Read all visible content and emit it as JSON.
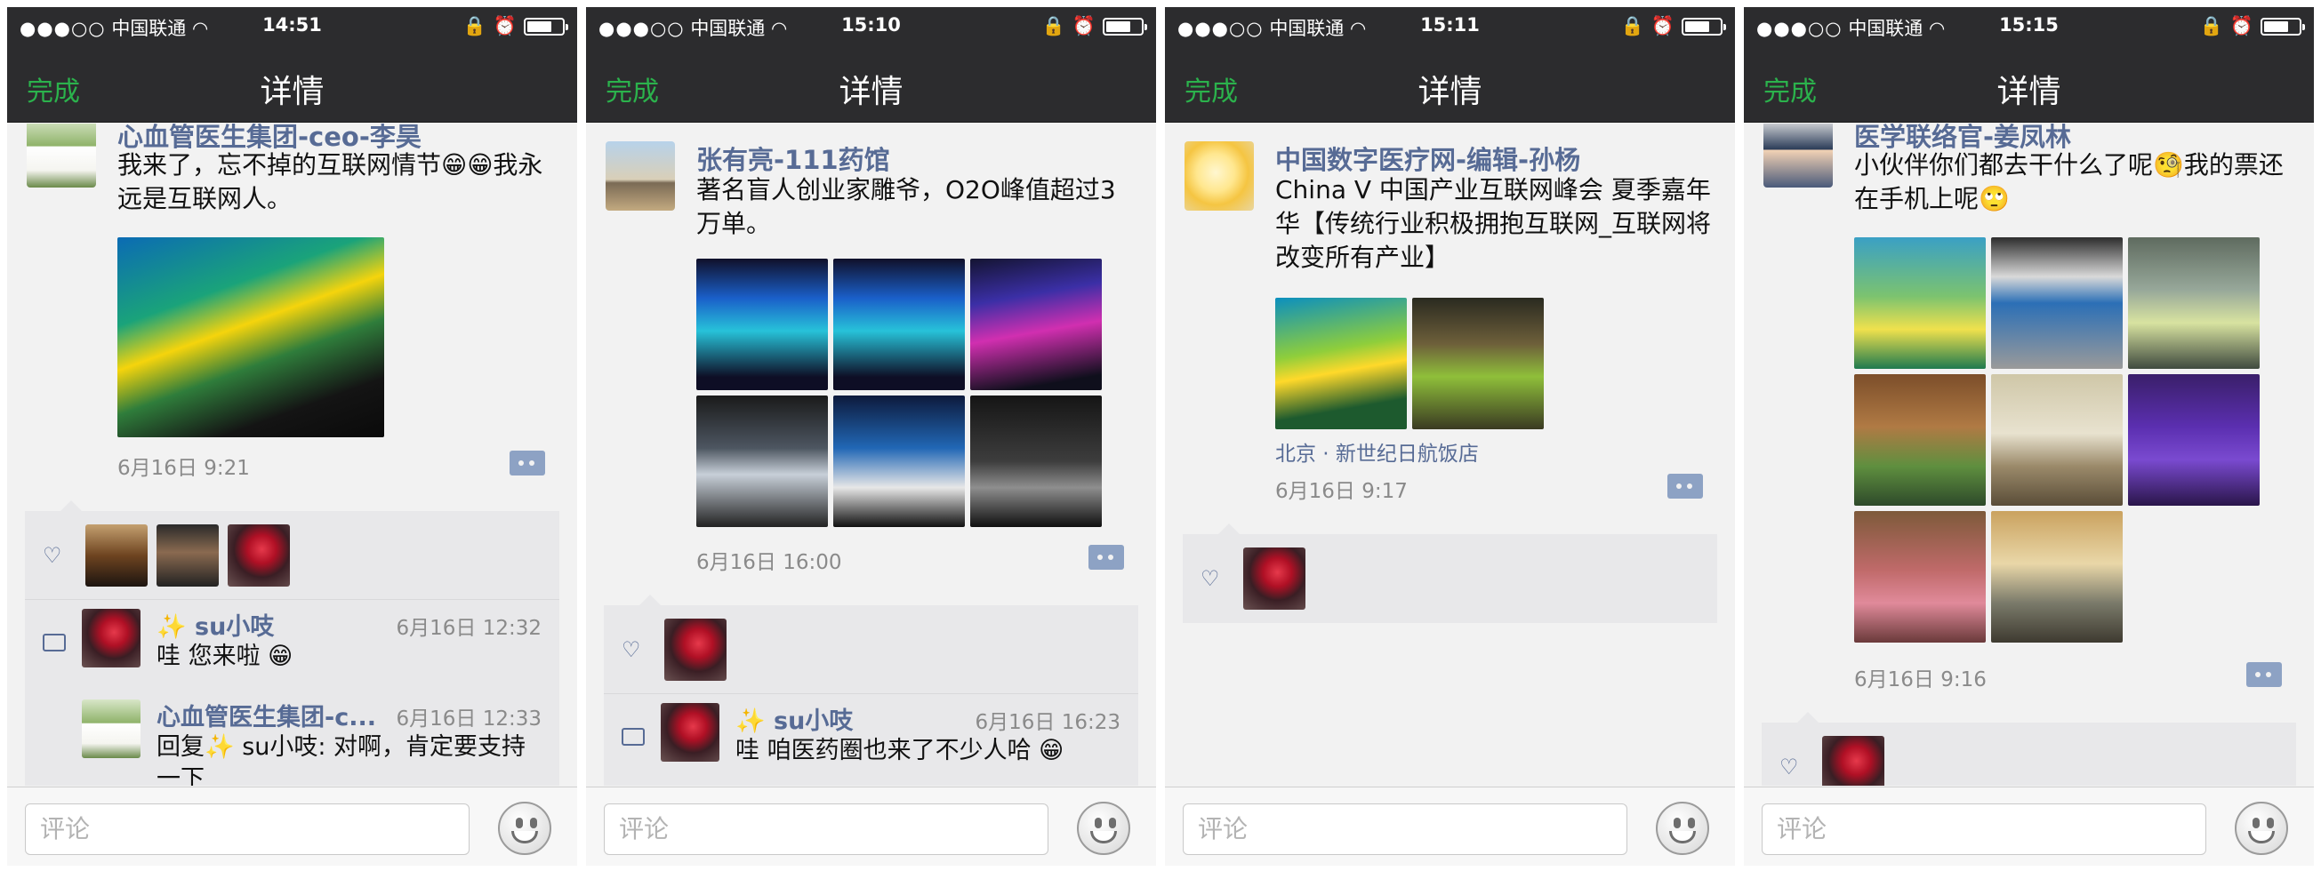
{
  "status_bar": {
    "carrier_dots": "●●●○○",
    "carrier": "中国联通"
  },
  "nav": {
    "done_label": "完成",
    "title": "详情"
  },
  "footer": {
    "comment_placeholder": "评论"
  },
  "screens": [
    {
      "time": "14:51",
      "post": {
        "author": "心血管医生集团-ceo-李昊",
        "text": "我来了，忘不掉的互联网情节😁😁我永远是互联网人。",
        "time": "6月16日 9:21"
      },
      "comments": [
        {
          "name": "✨ su小吱",
          "time": "6月16日 12:32",
          "text": "哇 您来啦 😁"
        },
        {
          "name": "心血管医生集团-c...",
          "time": "6月16日 12:33",
          "text": "回复✨ su小吱: 对啊，肯定要支持一下"
        }
      ]
    },
    {
      "time": "15:10",
      "post": {
        "author": "张有亮-111药馆",
        "text": "著名盲人创业家雕爷，O2O峰值超过3万单。",
        "time": "6月16日 16:00"
      },
      "comments": [
        {
          "name": "✨ su小吱",
          "time": "6月16日 16:23",
          "text": "哇 咱医药圈也来了不少人哈 😁"
        }
      ]
    },
    {
      "time": "15:11",
      "post": {
        "author": "中国数字医疗网-编辑-孙杨",
        "text": "China V 中国产业互联网峰会 夏季嘉年华【传统行业积极拥抱互联网_互联网将改变所有产业】",
        "location": "北京 · 新世纪日航饭店",
        "time": "6月16日 9:17"
      }
    },
    {
      "time": "15:15",
      "post": {
        "author": "医学联络官-姜凤林",
        "text": "小伙伴你们都去干什么了呢🧐我的票还在手机上呢🙄",
        "time": "6月16日 9:16"
      }
    }
  ]
}
